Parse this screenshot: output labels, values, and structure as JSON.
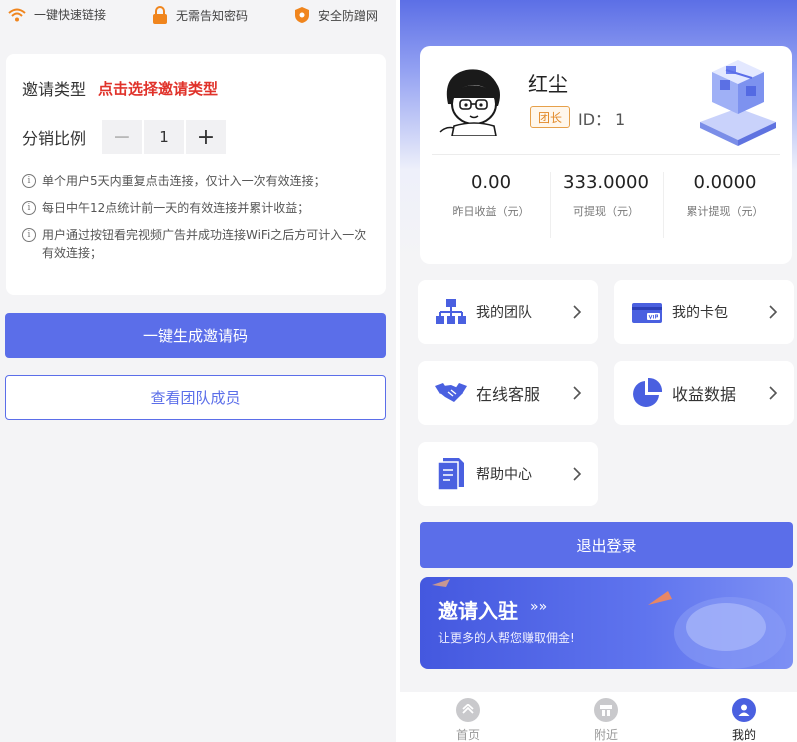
{
  "left": {
    "features": [
      {
        "icon": "wifi-icon",
        "label": "一键快速链接"
      },
      {
        "icon": "lock-icon",
        "label": "无需告知密码"
      },
      {
        "icon": "shield-icon",
        "label": "安全防蹭网"
      }
    ],
    "invite_type_label": "邀请类型",
    "invite_type_select": "点击选择邀请类型",
    "ratio_label": "分销比例",
    "ratio_minus": "−",
    "ratio_value": "1",
    "ratio_plus": "+",
    "notes": [
      "单个用户5天内重复点击连接，仅计入一次有效连接；",
      "每日中午12点统计前一天的有效连接并累计收益；",
      "用户通过按钮看完视频广告并成功连接WiFi之后方可计入一次有效连接；"
    ],
    "note_icon": "i",
    "generate_button": "一键生成邀请码",
    "view_team_button": "查看团队成员"
  },
  "profile": {
    "name": "红尘",
    "role": "团长",
    "id_label": "ID：",
    "id_value": "1",
    "stats": [
      {
        "value": "0.00",
        "label": "昨日收益（元）"
      },
      {
        "value": "333.0000",
        "label": "可提现（元）"
      },
      {
        "value": "0.0000",
        "label": "累计提现（元）"
      }
    ]
  },
  "menu": [
    {
      "label": "我的团队",
      "icon": "team-icon"
    },
    {
      "label": "我的卡包",
      "icon": "vip-card-icon"
    },
    {
      "label": "在线客服",
      "icon": "handshake-icon"
    },
    {
      "label": "收益数据",
      "icon": "pie-chart-icon"
    },
    {
      "label": "帮助中心",
      "icon": "document-icon"
    }
  ],
  "logout_button": "退出登录",
  "banner": {
    "title": "邀请入驻",
    "arrow": "»»",
    "subtitle": "让更多的人帮您赚取佣金!"
  },
  "tabs": [
    {
      "label": "首页",
      "icon": "home-icon"
    },
    {
      "label": "附近",
      "icon": "nearby-icon"
    },
    {
      "label": "我的",
      "icon": "user-icon"
    }
  ],
  "colors": {
    "primary": "#5b6ee9",
    "accent_red": "#e0322a",
    "badge_orange": "#e28a2a",
    "feature_orange": "#f0851d"
  }
}
